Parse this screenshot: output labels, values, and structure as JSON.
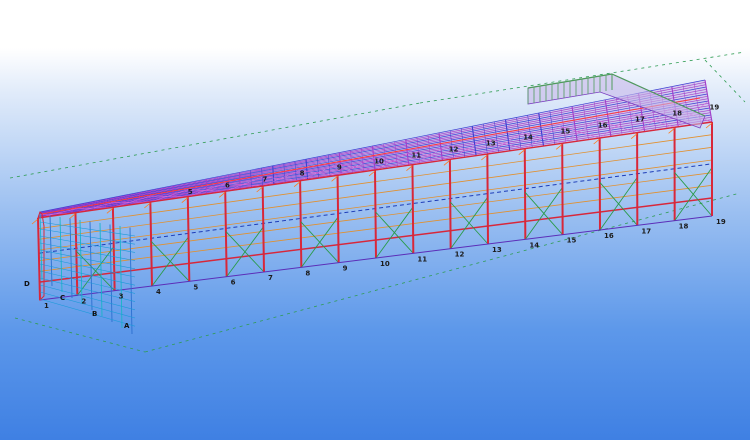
{
  "viewer": {
    "name": "3D steel structure model view",
    "colors": {
      "background_top": "#ffffff",
      "background_bottom": "#3f80e3",
      "roof_purge": "#a23ec9",
      "roof_blue": "#3b3fd2",
      "column": "#d8273a",
      "girt": "#e2902e",
      "bracing": "#2a9b4a",
      "grid_line": "#2f9c53"
    }
  },
  "grid_labels": {
    "front_axes": [
      "1",
      "2",
      "3",
      "4",
      "5",
      "6",
      "7",
      "8",
      "9",
      "10",
      "11",
      "12",
      "13",
      "14",
      "15",
      "16",
      "17",
      "18",
      "19"
    ],
    "roof_axes": [
      "5",
      "6",
      "7",
      "8",
      "9",
      "10",
      "11",
      "12",
      "13",
      "14",
      "15",
      "16",
      "17",
      "18",
      "19"
    ],
    "side_axes": [
      "A",
      "B",
      "C",
      "D"
    ]
  }
}
